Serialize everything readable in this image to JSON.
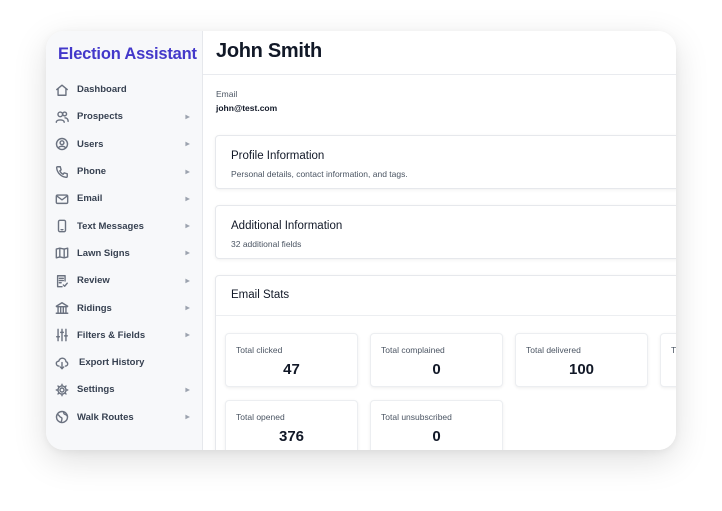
{
  "sidebar": {
    "brand": "Election Assistant",
    "items": [
      {
        "label": "Dashboard",
        "icon": "home-icon",
        "chevron": false
      },
      {
        "label": "Prospects",
        "icon": "users-group-icon",
        "chevron": true
      },
      {
        "label": "Users",
        "icon": "user-circle-icon",
        "chevron": true
      },
      {
        "label": "Phone",
        "icon": "phone-icon",
        "chevron": true
      },
      {
        "label": "Email",
        "icon": "envelope-icon",
        "chevron": true
      },
      {
        "label": "Text Messages",
        "icon": "mobile-icon",
        "chevron": true
      },
      {
        "label": "Lawn Signs",
        "icon": "map-icon",
        "chevron": true
      },
      {
        "label": "Review",
        "icon": "document-check-icon",
        "chevron": true
      },
      {
        "label": "Ridings",
        "icon": "building-icon",
        "chevron": true
      },
      {
        "label": "Filters & Fields",
        "icon": "sliders-icon",
        "chevron": true
      },
      {
        "label": "Export History",
        "icon": "cloud-download-icon",
        "chevron": false
      },
      {
        "label": "Settings",
        "icon": "gear-icon",
        "chevron": true
      },
      {
        "label": "Walk Routes",
        "icon": "globe-icon",
        "chevron": true
      }
    ]
  },
  "chevron_glyph": "▶",
  "contact": {
    "name": "John Smith",
    "email_label": "Email",
    "email_value": "john@test.com"
  },
  "sections": {
    "profile": {
      "title": "Profile Information",
      "subtitle": "Personal details, contact information, and tags."
    },
    "additional": {
      "title": "Additional Information",
      "subtitle": "32 additional fields"
    },
    "email_stats": {
      "title": "Email Stats"
    }
  },
  "stats": [
    {
      "label": "Total clicked",
      "value": "47"
    },
    {
      "label": "Total complained",
      "value": "0"
    },
    {
      "label": "Total delivered",
      "value": "100"
    },
    {
      "label": "T",
      "value": ""
    },
    {
      "label": "Total opened",
      "value": "376"
    },
    {
      "label": "Total unsubscribed",
      "value": "0"
    }
  ],
  "colors": {
    "brand": "#4338ca",
    "sidebar_bg": "#f7f8fa",
    "text_primary": "#111827",
    "text_secondary": "#4b5563"
  }
}
